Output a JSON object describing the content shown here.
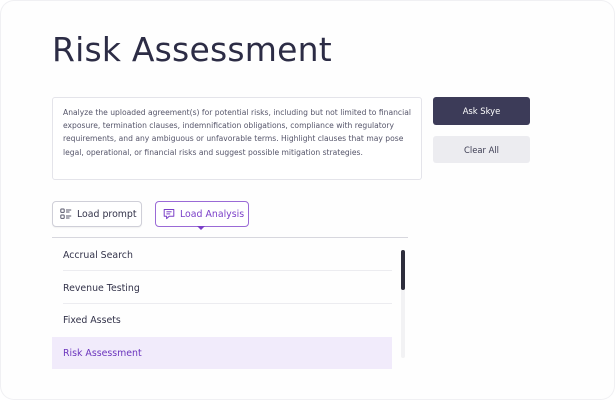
{
  "page": {
    "title": "Risk Assessment"
  },
  "prompt": {
    "text": "Analyze the uploaded agreement(s) for potential risks, including but not limited to financial exposure, termination clauses, indemnification obligations, compliance with regulatory requirements, and any ambiguous or unfavorable terms. Highlight clauses that may pose legal, operational, or financial risks and suggest possible mitigation strategies."
  },
  "actions": {
    "ask_label": "Ask Skye",
    "clear_label": "Clear All"
  },
  "tabs": [
    {
      "label": "Load prompt",
      "icon": "list-icon",
      "active": false
    },
    {
      "label": "Load Analysis",
      "icon": "chat-analysis-icon",
      "active": true
    }
  ],
  "list": {
    "items": [
      {
        "label": "Accrual Search",
        "selected": false
      },
      {
        "label": "Revenue Testing",
        "selected": false
      },
      {
        "label": "Fixed Assets",
        "selected": false
      },
      {
        "label": "Risk Assessment",
        "selected": true
      }
    ]
  },
  "colors": {
    "accent": "#7b3fc8",
    "primary_button": "#3c3b58",
    "title_text": "#2c2c45",
    "selected_row_bg": "#f1ebfb"
  }
}
